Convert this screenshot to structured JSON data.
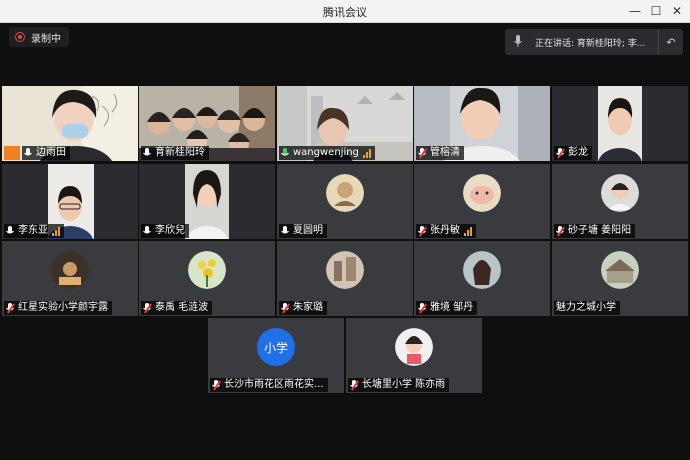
{
  "window": {
    "title": "腾讯会议",
    "minimize": "—",
    "maximize": "☐",
    "close": "✕"
  },
  "recording": {
    "label": "录制中"
  },
  "speaking": {
    "text": "正在讲话: 育新桂阳玲; 李..."
  },
  "tiles": [
    {
      "name": "边雨田",
      "muted": false,
      "host": true,
      "signal": false
    },
    {
      "name": "育新桂阳玲",
      "muted": false,
      "host": false,
      "signal": false
    },
    {
      "name": "wangwenjing",
      "muted": false,
      "host": false,
      "signal": true,
      "speaking": true
    },
    {
      "name": "管榕清",
      "muted": true,
      "host": false,
      "signal": false
    },
    {
      "name": "彭龙",
      "muted": true,
      "host": false,
      "signal": false
    },
    {
      "name": "李东亚",
      "muted": false,
      "host": false,
      "signal": true
    },
    {
      "name": "李欣兒",
      "muted": false,
      "host": false,
      "signal": false
    },
    {
      "name": "夏圆明",
      "muted": false,
      "host": false,
      "signal": false
    },
    {
      "name": "张丹敏",
      "muted": true,
      "host": false,
      "signal": true
    },
    {
      "name": "砂子塘 姜阳阳",
      "muted": true,
      "host": false,
      "signal": false
    },
    {
      "name": "红星实验小学颜宇露",
      "muted": true,
      "host": false,
      "signal": false
    },
    {
      "name": "泰禹 毛涟波",
      "muted": true,
      "host": false,
      "signal": false
    },
    {
      "name": "朱家璐",
      "muted": true,
      "host": false,
      "signal": false
    },
    {
      "name": "雅境 邹丹",
      "muted": true,
      "host": false,
      "signal": false
    },
    {
      "name": "魅力之城小学",
      "muted": false,
      "host": false,
      "signal": false,
      "noicon": true
    },
    {
      "name": "长沙市雨花区雨花实...",
      "muted": true,
      "host": false,
      "signal": false
    },
    {
      "name": "长塘里小学 陈亦雨",
      "muted": true,
      "host": false,
      "signal": false
    }
  ],
  "text_avatar": {
    "text": "小学",
    "color": "#1e6fe8"
  }
}
